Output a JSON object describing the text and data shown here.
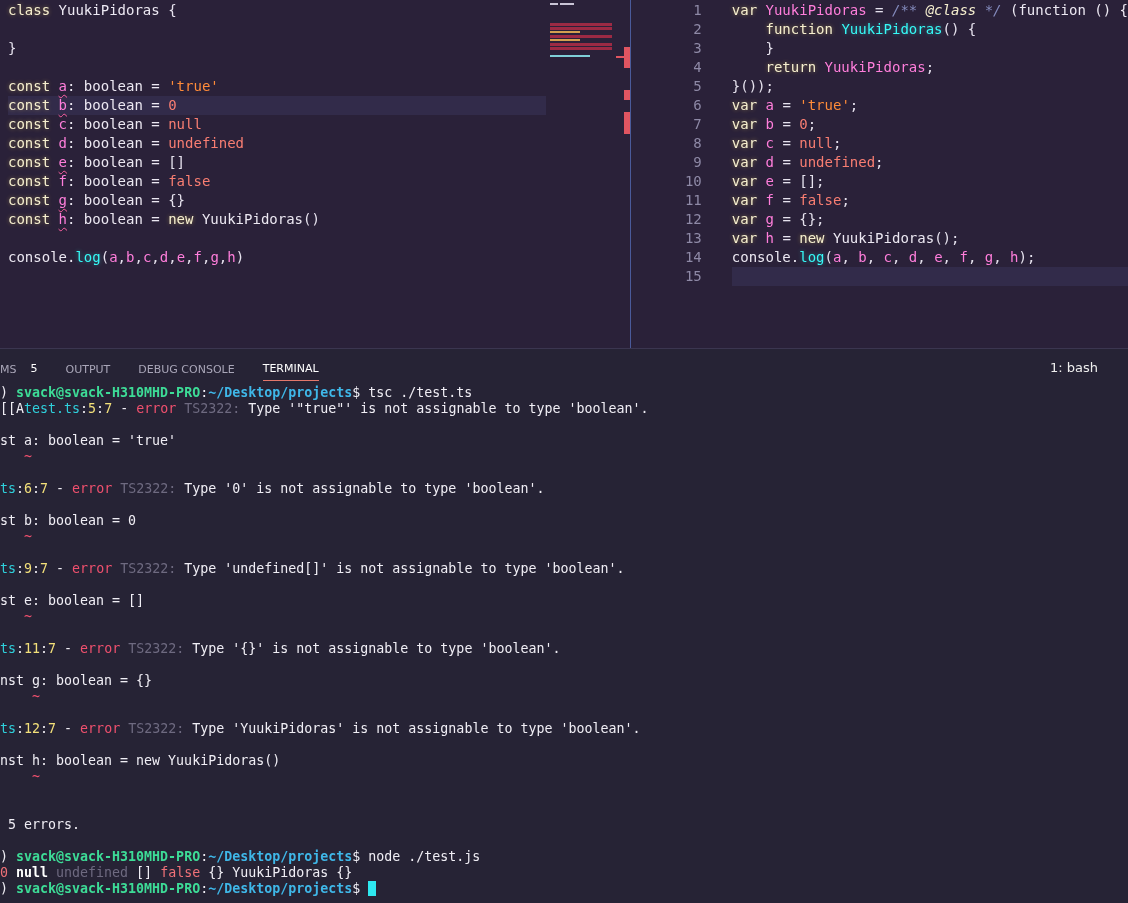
{
  "editor_left": {
    "lines": [
      {
        "current": false,
        "tokens": [
          {
            "text": "class ",
            "kind": "keyword"
          },
          {
            "text": "YuukiPidoras",
            "kind": "type"
          },
          {
            "text": " {",
            "kind": "punct"
          }
        ]
      },
      {
        "current": false
      },
      {
        "current": false,
        "tokens": [
          {
            "text": "}",
            "kind": "punct"
          }
        ]
      },
      {
        "current": false
      },
      {
        "current": false,
        "error": true,
        "tokens": [
          {
            "text": "const ",
            "kind": "keyword"
          },
          {
            "text": "a",
            "kind": "var"
          },
          {
            "text": ": boolean = ",
            "kind": "type"
          },
          {
            "text": "'true'",
            "kind": "string"
          }
        ]
      },
      {
        "current": true,
        "error": true,
        "tokens": [
          {
            "text": "const ",
            "kind": "keyword"
          },
          {
            "text": "b",
            "kind": "var"
          },
          {
            "text": ": boolean = ",
            "kind": "type"
          },
          {
            "text": "0",
            "kind": "constant"
          }
        ]
      },
      {
        "current": false,
        "error": false,
        "tokens": [
          {
            "text": "const ",
            "kind": "keyword"
          },
          {
            "text": "c",
            "kind": "var"
          },
          {
            "text": ": boolean = ",
            "kind": "type"
          },
          {
            "text": "null",
            "kind": "constant"
          }
        ]
      },
      {
        "current": false,
        "error": false,
        "tokens": [
          {
            "text": "const ",
            "kind": "keyword"
          },
          {
            "text": "d",
            "kind": "var"
          },
          {
            "text": ": boolean = ",
            "kind": "type"
          },
          {
            "text": "undefined",
            "kind": "constant"
          }
        ]
      },
      {
        "current": false,
        "error": true,
        "tokens": [
          {
            "text": "const ",
            "kind": "keyword"
          },
          {
            "text": "e",
            "kind": "var"
          },
          {
            "text": ": boolean = ",
            "kind": "type"
          },
          {
            "text": "[]",
            "kind": "punct"
          }
        ]
      },
      {
        "current": false,
        "error": false,
        "tokens": [
          {
            "text": "const ",
            "kind": "keyword"
          },
          {
            "text": "f",
            "kind": "var"
          },
          {
            "text": ": boolean = ",
            "kind": "type"
          },
          {
            "text": "false",
            "kind": "constant"
          }
        ]
      },
      {
        "current": false,
        "error": true,
        "tokens": [
          {
            "text": "const ",
            "kind": "keyword"
          },
          {
            "text": "g",
            "kind": "var"
          },
          {
            "text": ": boolean = ",
            "kind": "type"
          },
          {
            "text": "{}",
            "kind": "punct"
          }
        ]
      },
      {
        "current": false,
        "error": true,
        "tokens": [
          {
            "text": "const ",
            "kind": "keyword"
          },
          {
            "text": "h",
            "kind": "var"
          },
          {
            "text": ": boolean = ",
            "kind": "type"
          },
          {
            "text": "new",
            "kind": "keyword"
          },
          {
            "text": " YuukiPidoras",
            "kind": "type"
          },
          {
            "text": "()",
            "kind": "punct"
          }
        ]
      },
      {
        "current": false
      },
      {
        "current": false,
        "error": false,
        "tokens": [
          {
            "text": "console.",
            "kind": "type"
          },
          {
            "text": "log",
            "kind": "function"
          },
          {
            "text": "(",
            "kind": "punct"
          },
          {
            "text": "a",
            "kind": "var"
          },
          {
            "text": ",",
            "kind": "punct"
          },
          {
            "text": "b",
            "kind": "var"
          },
          {
            "text": ",",
            "kind": "punct"
          },
          {
            "text": "c",
            "kind": "var"
          },
          {
            "text": ",",
            "kind": "punct"
          },
          {
            "text": "d",
            "kind": "var"
          },
          {
            "text": ",",
            "kind": "punct"
          },
          {
            "text": "e",
            "kind": "var"
          },
          {
            "text": ",",
            "kind": "punct"
          },
          {
            "text": "f",
            "kind": "var"
          },
          {
            "text": ",",
            "kind": "punct"
          },
          {
            "text": "g",
            "kind": "var"
          },
          {
            "text": ",",
            "kind": "punct"
          },
          {
            "text": "h",
            "kind": "var"
          },
          {
            "text": ")",
            "kind": "punct"
          }
        ]
      }
    ]
  },
  "editor_right": {
    "lines": [
      {
        "number": "1",
        "current": false,
        "tokens": [
          {
            "text": "var ",
            "kind": "keyword"
          },
          {
            "text": "YuukiPidoras",
            "kind": "var"
          },
          {
            "text": " = ",
            "kind": "punct"
          },
          {
            "text": "/** ",
            "kind": "comment"
          },
          {
            "text": "@class",
            "kind": "tag"
          },
          {
            "text": " */",
            "kind": "comment"
          },
          {
            "text": " (function () {",
            "kind": "type"
          }
        ]
      },
      {
        "number": "2",
        "current": false,
        "tokens": [
          {
            "text": "    function ",
            "kind": "keyword"
          },
          {
            "text": "YuukiPidoras",
            "kind": "function"
          },
          {
            "text": "() {",
            "kind": "punct"
          }
        ]
      },
      {
        "number": "3",
        "current": false,
        "tokens": [
          {
            "text": "    }",
            "kind": "punct"
          }
        ]
      },
      {
        "number": "4",
        "current": false,
        "tokens": [
          {
            "text": "    return ",
            "kind": "keyword"
          },
          {
            "text": "YuukiPidoras",
            "kind": "var"
          },
          {
            "text": ";",
            "kind": "punct"
          }
        ]
      },
      {
        "number": "5",
        "current": false,
        "tokens": [
          {
            "text": "}());",
            "kind": "punct"
          }
        ]
      },
      {
        "number": "6",
        "current": false,
        "tokens": [
          {
            "text": "var ",
            "kind": "keyword"
          },
          {
            "text": "a",
            "kind": "var"
          },
          {
            "text": " = ",
            "kind": "punct"
          },
          {
            "text": "'true'",
            "kind": "string"
          },
          {
            "text": ";",
            "kind": "punct"
          }
        ]
      },
      {
        "number": "7",
        "current": false,
        "tokens": [
          {
            "text": "var ",
            "kind": "keyword"
          },
          {
            "text": "b",
            "kind": "var"
          },
          {
            "text": " = ",
            "kind": "punct"
          },
          {
            "text": "0",
            "kind": "constant"
          },
          {
            "text": ";",
            "kind": "punct"
          }
        ]
      },
      {
        "number": "8",
        "current": false,
        "tokens": [
          {
            "text": "var ",
            "kind": "keyword"
          },
          {
            "text": "c",
            "kind": "var"
          },
          {
            "text": " = ",
            "kind": "punct"
          },
          {
            "text": "null",
            "kind": "constant"
          },
          {
            "text": ";",
            "kind": "punct"
          }
        ]
      },
      {
        "number": "9",
        "current": false,
        "tokens": [
          {
            "text": "var ",
            "kind": "keyword"
          },
          {
            "text": "d",
            "kind": "var"
          },
          {
            "text": " = ",
            "kind": "punct"
          },
          {
            "text": "undefined",
            "kind": "constant"
          },
          {
            "text": ";",
            "kind": "punct"
          }
        ]
      },
      {
        "number": "10",
        "current": false,
        "tokens": [
          {
            "text": "var ",
            "kind": "keyword"
          },
          {
            "text": "e",
            "kind": "var"
          },
          {
            "text": " = [];",
            "kind": "punct"
          }
        ]
      },
      {
        "number": "11",
        "current": false,
        "tokens": [
          {
            "text": "var ",
            "kind": "keyword"
          },
          {
            "text": "f",
            "kind": "var"
          },
          {
            "text": " = ",
            "kind": "punct"
          },
          {
            "text": "false",
            "kind": "constant"
          },
          {
            "text": ";",
            "kind": "punct"
          }
        ]
      },
      {
        "number": "12",
        "current": false,
        "tokens": [
          {
            "text": "var ",
            "kind": "keyword"
          },
          {
            "text": "g",
            "kind": "var"
          },
          {
            "text": " = {};",
            "kind": "punct"
          }
        ]
      },
      {
        "number": "13",
        "current": false,
        "tokens": [
          {
            "text": "var ",
            "kind": "keyword"
          },
          {
            "text": "h",
            "kind": "var"
          },
          {
            "text": " = ",
            "kind": "punct"
          },
          {
            "text": "new",
            "kind": "keyword"
          },
          {
            "text": " YuukiPidoras",
            "kind": "type"
          },
          {
            "text": "();",
            "kind": "punct"
          }
        ]
      },
      {
        "number": "14",
        "current": false,
        "tokens": [
          {
            "text": "console.",
            "kind": "type"
          },
          {
            "text": "log",
            "kind": "function"
          },
          {
            "text": "(",
            "kind": "punct"
          },
          {
            "text": "a",
            "kind": "var"
          },
          {
            "text": ", ",
            "kind": "punct"
          },
          {
            "text": "b",
            "kind": "var"
          },
          {
            "text": ", ",
            "kind": "punct"
          },
          {
            "text": "c",
            "kind": "var"
          },
          {
            "text": ", ",
            "kind": "punct"
          },
          {
            "text": "d",
            "kind": "var"
          },
          {
            "text": ", ",
            "kind": "punct"
          },
          {
            "text": "e",
            "kind": "var"
          },
          {
            "text": ", ",
            "kind": "punct"
          },
          {
            "text": "f",
            "kind": "var"
          },
          {
            "text": ", ",
            "kind": "punct"
          },
          {
            "text": "g",
            "kind": "var"
          },
          {
            "text": ", ",
            "kind": "punct"
          },
          {
            "text": "h",
            "kind": "var"
          },
          {
            "text": ");",
            "kind": "punct"
          }
        ]
      },
      {
        "number": "15",
        "current": true
      }
    ]
  },
  "panel": {
    "tabs": [
      {
        "label": "MS",
        "badge": "5",
        "selected": false
      },
      {
        "label": "OUTPUT",
        "selected": false
      },
      {
        "label": "DEBUG CONSOLE",
        "selected": false
      },
      {
        "label": "TERMINAL",
        "selected": true
      }
    ],
    "terminal_select": "1: bash"
  },
  "terminal": {
    "cursor": true,
    "lines": [
      {
        "kind": "flush",
        "tokens": [
          {
            "text": ") ",
            "kind": "plain"
          },
          {
            "text": "svack@svack-H310MHD-PRO",
            "kind": "user"
          },
          {
            "text": ":",
            "kind": "plain"
          },
          {
            "text": "~/Desktop/projects",
            "kind": "path"
          },
          {
            "text": "$ tsc ./test.ts",
            "kind": "plain"
          }
        ]
      },
      {
        "kind": "flush",
        "tokens": [
          {
            "text": "[[A",
            "kind": "plain"
          },
          {
            "text": "test.ts",
            "kind": "file"
          },
          {
            "text": ":",
            "kind": "plain"
          },
          {
            "text": "5",
            "kind": "loc"
          },
          {
            "text": ":",
            "kind": "plain"
          },
          {
            "text": "7",
            "kind": "loc"
          },
          {
            "text": " - ",
            "kind": "plain"
          },
          {
            "text": "error",
            "kind": "error"
          },
          {
            "text": " TS2322:",
            "kind": "dim"
          },
          {
            "text": " Type '\"true\"' is not assignable to type 'boolean'.",
            "kind": "plain"
          }
        ]
      },
      {
        "kind": "spaced",
        "tokens": [
          {
            "text": "st a: boolean = 'true'",
            "kind": "plain"
          }
        ]
      },
      {
        "kind": "flush",
        "tokens": [
          {
            "text": "   ~",
            "kind": "error"
          }
        ]
      },
      {
        "kind": "spaced",
        "tokens": [
          {
            "text": "ts",
            "kind": "file"
          },
          {
            "text": ":",
            "kind": "plain"
          },
          {
            "text": "6",
            "kind": "loc"
          },
          {
            "text": ":",
            "kind": "plain"
          },
          {
            "text": "7",
            "kind": "loc"
          },
          {
            "text": " - ",
            "kind": "plain"
          },
          {
            "text": "error",
            "kind": "error"
          },
          {
            "text": " TS2322:",
            "kind": "dim"
          },
          {
            "text": " Type '0' is not assignable to type 'boolean'.",
            "kind": "plain"
          }
        ]
      },
      {
        "kind": "spaced",
        "tokens": [
          {
            "text": "st b: boolean = 0",
            "kind": "plain"
          }
        ]
      },
      {
        "kind": "flush",
        "tokens": [
          {
            "text": "   ~",
            "kind": "error"
          }
        ]
      },
      {
        "kind": "spaced",
        "tokens": [
          {
            "text": "ts",
            "kind": "file"
          },
          {
            "text": ":",
            "kind": "plain"
          },
          {
            "text": "9",
            "kind": "loc"
          },
          {
            "text": ":",
            "kind": "plain"
          },
          {
            "text": "7",
            "kind": "loc"
          },
          {
            "text": " - ",
            "kind": "plain"
          },
          {
            "text": "error",
            "kind": "error"
          },
          {
            "text": " TS2322:",
            "kind": "dim"
          },
          {
            "text": " Type 'undefined[]' is not assignable to type 'boolean'.",
            "kind": "plain"
          }
        ]
      },
      {
        "kind": "spaced",
        "tokens": [
          {
            "text": "st e: boolean = []",
            "kind": "plain"
          }
        ]
      },
      {
        "kind": "flush",
        "tokens": [
          {
            "text": "   ~",
            "kind": "error"
          }
        ]
      },
      {
        "kind": "spaced",
        "tokens": [
          {
            "text": "ts",
            "kind": "file"
          },
          {
            "text": ":",
            "kind": "plain"
          },
          {
            "text": "11",
            "kind": "loc"
          },
          {
            "text": ":",
            "kind": "plain"
          },
          {
            "text": "7",
            "kind": "loc"
          },
          {
            "text": " - ",
            "kind": "plain"
          },
          {
            "text": "error",
            "kind": "error"
          },
          {
            "text": " TS2322:",
            "kind": "dim"
          },
          {
            "text": " Type '{}' is not assignable to type 'boolean'.",
            "kind": "plain"
          }
        ]
      },
      {
        "kind": "spaced",
        "tokens": [
          {
            "text": "nst g: boolean = {}",
            "kind": "plain"
          }
        ]
      },
      {
        "kind": "flush",
        "tokens": [
          {
            "text": "    ~",
            "kind": "error"
          }
        ]
      },
      {
        "kind": "spaced",
        "tokens": [
          {
            "text": "ts",
            "kind": "file"
          },
          {
            "text": ":",
            "kind": "plain"
          },
          {
            "text": "12",
            "kind": "loc"
          },
          {
            "text": ":",
            "kind": "plain"
          },
          {
            "text": "7",
            "kind": "loc"
          },
          {
            "text": " - ",
            "kind": "plain"
          },
          {
            "text": "error",
            "kind": "error"
          },
          {
            "text": " TS2322:",
            "kind": "dim"
          },
          {
            "text": " Type 'YuukiPidoras' is not assignable to type 'boolean'.",
            "kind": "plain"
          }
        ]
      },
      {
        "kind": "spaced",
        "tokens": [
          {
            "text": "nst h: boolean = new YuukiPidoras()",
            "kind": "plain"
          }
        ]
      },
      {
        "kind": "flush",
        "tokens": [
          {
            "text": "    ~",
            "kind": "error"
          }
        ]
      },
      {
        "kind": "double_spaced",
        "tokens": [
          {
            "text": " 5 errors.",
            "kind": "plain"
          }
        ]
      },
      {
        "kind": "spaced",
        "tokens": [
          {
            "text": ") ",
            "kind": "plain"
          },
          {
            "text": "svack@svack-H310MHD-PRO",
            "kind": "user"
          },
          {
            "text": ":",
            "kind": "plain"
          },
          {
            "text": "~/Desktop/projects",
            "kind": "path"
          },
          {
            "text": "$ node ./test.js",
            "kind": "plain"
          }
        ]
      },
      {
        "kind": "flush",
        "tokens": [
          {
            "text": "0",
            "kind": "number"
          },
          {
            "text": " null",
            "kind": "strong"
          },
          {
            "text": " undefined",
            "kind": "dim"
          },
          {
            "text": " [] ",
            "kind": "plain"
          },
          {
            "text": "false",
            "kind": "number"
          },
          {
            "text": " {} YuukiPidoras {}",
            "kind": "plain"
          }
        ]
      },
      {
        "kind": "flush",
        "tokens": [
          {
            "text": ") ",
            "kind": "plain"
          },
          {
            "text": "svack@svack-H310MHD-PRO",
            "kind": "user"
          },
          {
            "text": ":",
            "kind": "plain"
          },
          {
            "text": "~/Desktop/projects",
            "kind": "path"
          },
          {
            "text": "$ ",
            "kind": "plain"
          }
        ]
      }
    ]
  }
}
